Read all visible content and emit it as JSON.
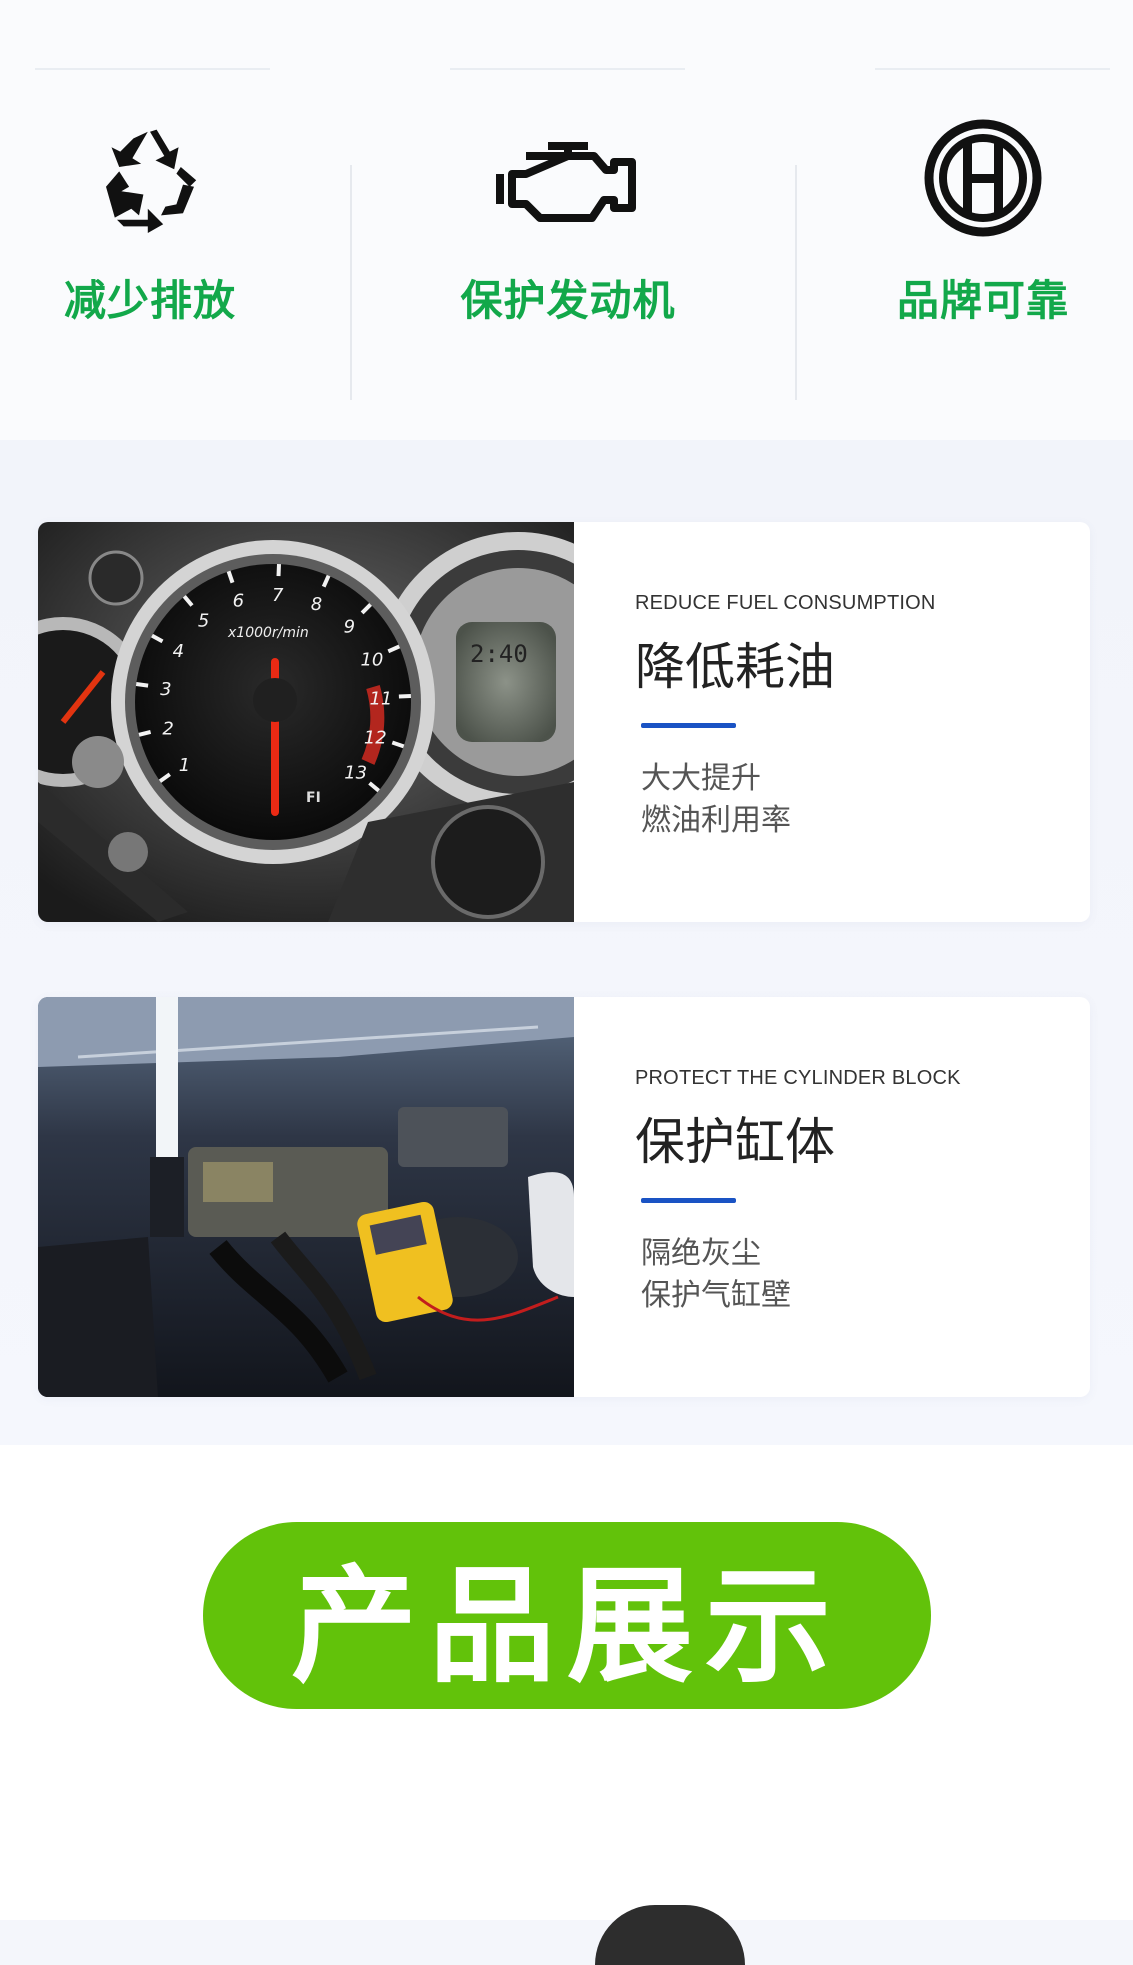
{
  "features": [
    {
      "label": "减少排放",
      "icon": "recycle-icon"
    },
    {
      "label": "保护发动机",
      "icon": "engine-icon"
    },
    {
      "label": "品牌可靠",
      "icon": "brand-logo-icon"
    }
  ],
  "cards": [
    {
      "en": "REDUCE FUEL CONSUMPTION",
      "zh": "降低耗油",
      "desc1": "大大提升",
      "desc2": "燃油利用率",
      "gauge_texts": {
        "unit": "x1000r/min",
        "clock": "2:40",
        "fi": "FI"
      },
      "gauge_ticks": [
        "1",
        "2",
        "3",
        "4",
        "5",
        "6",
        "7",
        "8",
        "9",
        "10",
        "11",
        "12",
        "13"
      ]
    },
    {
      "en": "PROTECT THE CYLINDER BLOCK",
      "zh": "保护缸体",
      "desc1": "隔绝灰尘",
      "desc2": "保护气缸壁"
    }
  ],
  "banner": {
    "title": "产品展示"
  },
  "colors": {
    "feature_green": "#12a84a",
    "accent_blue": "#1a53c4",
    "banner_green": "#62c20a"
  }
}
